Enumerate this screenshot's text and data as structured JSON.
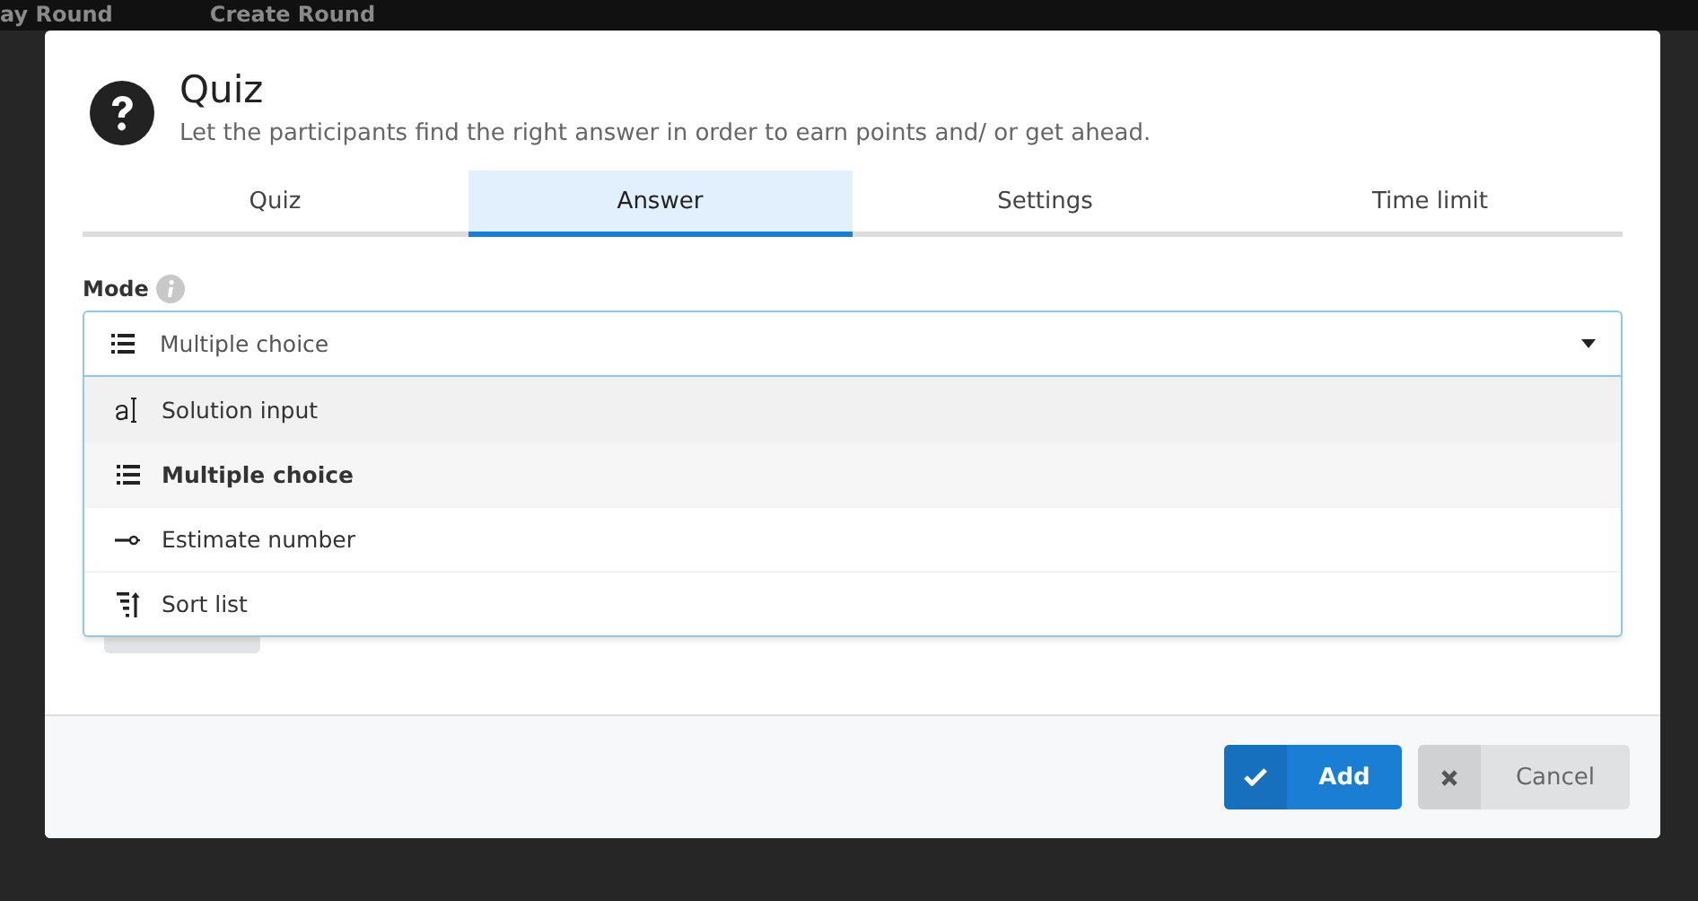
{
  "background_nav": [
    "ay Round",
    "Create Round"
  ],
  "dialog": {
    "title": "Quiz",
    "subtitle": "Let the participants find the right answer in order to earn points and/ or get ahead.",
    "tabs": [
      {
        "label": "Quiz",
        "selected": false
      },
      {
        "label": "Answer",
        "selected": true
      },
      {
        "label": "Settings",
        "selected": false
      },
      {
        "label": "Time limit",
        "selected": false
      }
    ],
    "mode": {
      "label": "Mode",
      "value": {
        "label": "Multiple choice",
        "kind": "list"
      },
      "expanded": true,
      "options": [
        {
          "label": "Solution input",
          "kind": "text",
          "selected": false,
          "highlighted": true
        },
        {
          "label": "Multiple choice",
          "kind": "list",
          "selected": true,
          "highlighted": false
        },
        {
          "label": "Estimate number",
          "kind": "slider",
          "selected": false,
          "highlighted": false
        },
        {
          "label": "Sort list",
          "kind": "sort",
          "selected": false,
          "highlighted": false
        }
      ]
    },
    "buttons": [
      {
        "label": "Add",
        "kind": "primary"
      },
      {
        "label": "Cancel",
        "kind": "secondary"
      }
    ]
  }
}
